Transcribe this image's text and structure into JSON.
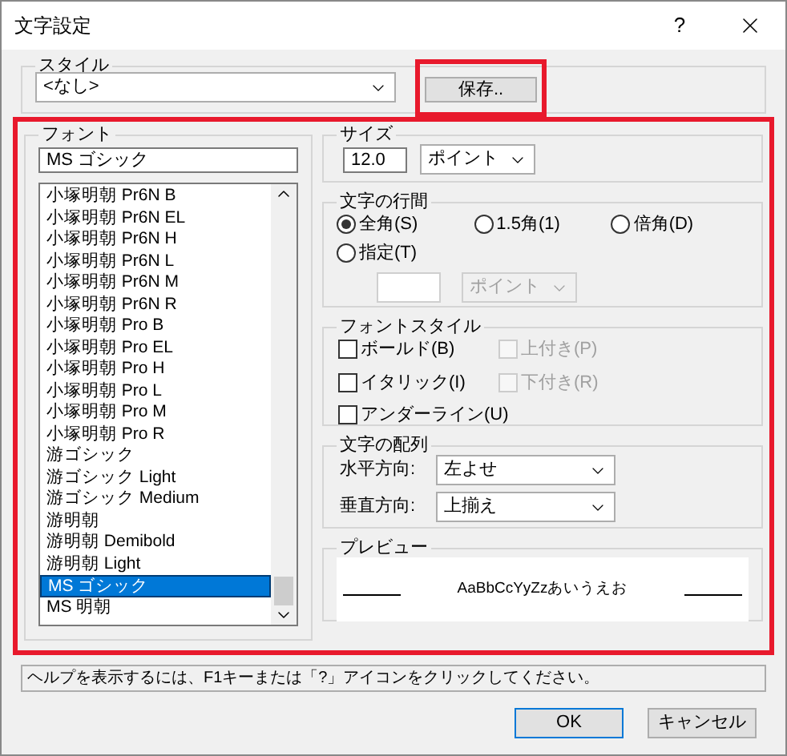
{
  "window": {
    "title": "文字設定",
    "help_button": "?"
  },
  "style": {
    "label": "スタイル",
    "value": "<なし>",
    "save_button": "保存..",
    "highlighted": true
  },
  "main_highlighted": true,
  "font": {
    "label": "フォント",
    "value": "MS ゴシック",
    "items": [
      {
        "label": "小塚明朝 Pr6N B",
        "selected": false
      },
      {
        "label": "小塚明朝 Pr6N EL",
        "selected": false
      },
      {
        "label": "小塚明朝 Pr6N H",
        "selected": false
      },
      {
        "label": "小塚明朝 Pr6N L",
        "selected": false
      },
      {
        "label": "小塚明朝 Pr6N M",
        "selected": false
      },
      {
        "label": "小塚明朝 Pr6N R",
        "selected": false
      },
      {
        "label": "小塚明朝 Pro B",
        "selected": false
      },
      {
        "label": "小塚明朝 Pro EL",
        "selected": false
      },
      {
        "label": "小塚明朝 Pro H",
        "selected": false
      },
      {
        "label": "小塚明朝 Pro L",
        "selected": false
      },
      {
        "label": "小塚明朝 Pro M",
        "selected": false
      },
      {
        "label": "小塚明朝 Pro R",
        "selected": false
      },
      {
        "label": "游ゴシック",
        "selected": false
      },
      {
        "label": "游ゴシック Light",
        "selected": false
      },
      {
        "label": "游ゴシック Medium",
        "selected": false
      },
      {
        "label": "游明朝",
        "selected": false
      },
      {
        "label": "游明朝 Demibold",
        "selected": false
      },
      {
        "label": "游明朝 Light",
        "selected": false
      },
      {
        "label": "MS ゴシック",
        "selected": true
      },
      {
        "label": "MS 明朝",
        "selected": false
      }
    ]
  },
  "size": {
    "label": "サイズ",
    "value": "12.0",
    "unit": "ポイント"
  },
  "line_spacing": {
    "label": "文字の行間",
    "options": [
      {
        "label": "全角(S)",
        "selected": true
      },
      {
        "label": "1.5角(1)",
        "selected": false
      },
      {
        "label": "倍角(D)",
        "selected": false
      },
      {
        "label": "指定(T)",
        "selected": false
      }
    ],
    "unit": "ポイント",
    "custom_disabled": true
  },
  "font_style": {
    "label": "フォントスタイル",
    "options": [
      {
        "label": "ボールド(B)",
        "checked": false,
        "disabled": false
      },
      {
        "label": "上付き(P)",
        "checked": false,
        "disabled": true
      },
      {
        "label": "イタリック(I)",
        "checked": false,
        "disabled": false
      },
      {
        "label": "下付き(R)",
        "checked": false,
        "disabled": true
      },
      {
        "label": "アンダーライン(U)",
        "checked": false,
        "disabled": false
      }
    ]
  },
  "alignment": {
    "label": "文字の配列",
    "rows": [
      {
        "label": "水平方向:",
        "value": "左よせ"
      },
      {
        "label": "垂直方向:",
        "value": "上揃え"
      }
    ]
  },
  "preview": {
    "label": "プレビュー",
    "sample": "AaBbCcYyZzあいうえお"
  },
  "status": "ヘルプを表示するには、F1キーまたは「?」アイコンをクリックしてください。",
  "buttons": [
    {
      "label": "OK",
      "default": true
    },
    {
      "label": "キャンセル",
      "default": false
    }
  ]
}
